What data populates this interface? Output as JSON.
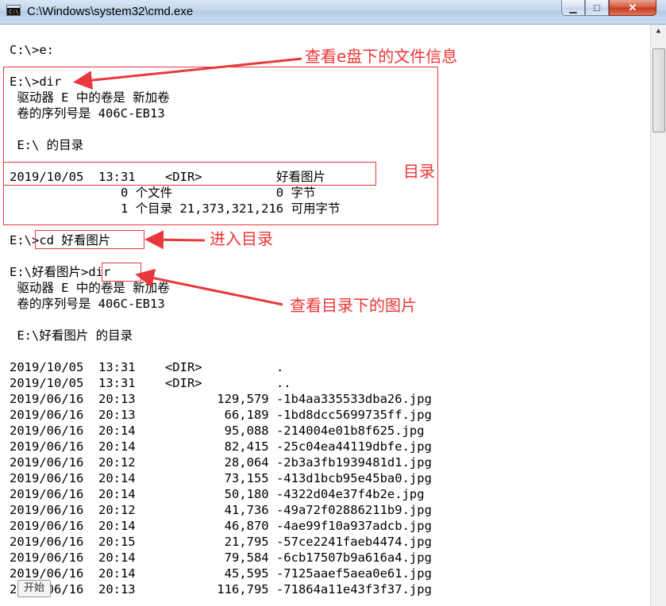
{
  "window": {
    "title": "C:\\Windows\\system32\\cmd.exe",
    "icon_text": "C:\\",
    "minimize_glyph": "▁",
    "maximize_glyph": "□",
    "close_glyph": "✕"
  },
  "console_lines": [
    "C:\\>e:",
    "E:\\>dir",
    " 驱动器 E 中的卷是 新加卷",
    " 卷的序列号是 406C-EB13",
    " E:\\ 的目录",
    "2019/10/05  13:31    <DIR>          好看图片",
    "               0 个文件              0 字节",
    "               1 个目录 21,373,321,216 可用字节",
    "E:\\>cd 好看图片",
    "E:\\好看图片>dir",
    " 驱动器 E 中的卷是 新加卷",
    " 卷的序列号是 406C-EB13",
    " E:\\好看图片 的目录",
    "2019/10/05  13:31    <DIR>          .",
    "2019/10/05  13:31    <DIR>          ..",
    "2019/06/16  20:13           129,579 -1b4aa335533dba26.jpg",
    "2019/06/16  20:13            66,189 -1bd8dcc5699735ff.jpg",
    "2019/06/16  20:14            95,088 -214004e01b8f625.jpg",
    "2019/06/16  20:14            82,415 -25c04ea44119dbfe.jpg",
    "2019/06/16  20:12            28,064 -2b3a3fb1939481d1.jpg",
    "2019/06/16  20:14            73,155 -413d1bcb95e45ba0.jpg",
    "2019/06/16  20:14            50,180 -4322d04e37f4b2e.jpg",
    "2019/06/16  20:12            41,736 -49a72f02886211b9.jpg",
    "2019/06/16  20:14            46,870 -4ae99f10a937adcb.jpg",
    "2019/06/16  20:15            21,795 -57ce2241faeb4474.jpg",
    "2019/06/16  20:14            79,584 -6cb17507b9a616a4.jpg",
    "2019/06/16  20:14            45,595 -7125aaef5aea0e61.jpg",
    "2019/06/16  20:13           116,795 -71864a11e43f3f37.jpg"
  ],
  "annotations": {
    "view_e_drive": "查看e盘下的文件信息",
    "directory": "目录",
    "enter_directory": "进入目录",
    "view_images": "查看目录下的图片"
  },
  "taskbar": {
    "start_label": "开始"
  },
  "colors": {
    "annotation": "#e8383d",
    "console_bg": "#ffffff",
    "console_text": "#000000"
  }
}
